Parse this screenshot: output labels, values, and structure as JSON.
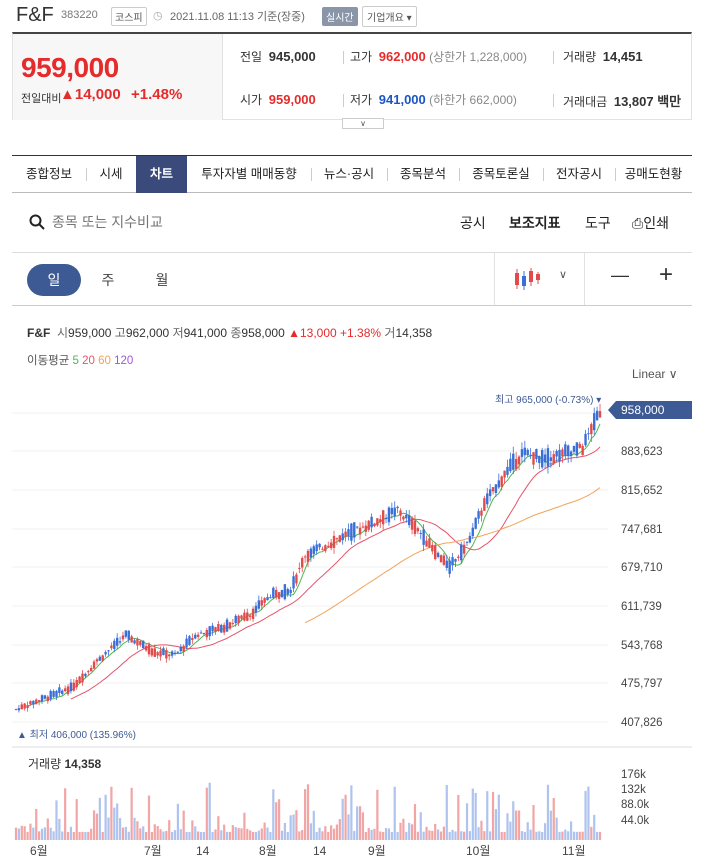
{
  "header": {
    "name": "F&F",
    "code": "383220",
    "market": "코스피",
    "time": "2021.11.08 11:13 기준(장중)",
    "realtime": "실시간",
    "company_info": "기업개요 ▾"
  },
  "quote": {
    "price": "959,000",
    "change_label": "전일대비",
    "change": "▲14,000",
    "change_pct": "+1.48%",
    "prev_label": "전일",
    "prev": "945,000",
    "high_label": "고가",
    "high": "962,000",
    "upper_limit": "(상한가 1,228,000)",
    "volume_label": "거래량",
    "volume": "14,451",
    "open_label": "시가",
    "open": "959,000",
    "low_label": "저가",
    "low": "941,000",
    "lower_limit": "(하한가 662,000)",
    "amount_label": "거래대금",
    "amount": "13,807 백만"
  },
  "tabs": [
    "종합정보",
    "시세",
    "차트",
    "투자자별 매매동향",
    "뉴스·공시",
    "종목분석",
    "종목토론실",
    "전자공시",
    "공매도현황"
  ],
  "search": {
    "placeholder": "종목 또는 지수비교"
  },
  "tools": {
    "disclosure": "공시",
    "indicator": "보조지표",
    "drawing": "도구",
    "print": "인쇄"
  },
  "periods": [
    "일",
    "주",
    "월"
  ],
  "controls": {
    "zoom_out": "—",
    "zoom_in": "+"
  },
  "info": {
    "name": "F&F",
    "open_label": "시",
    "open": "959,000",
    "high_label": "고",
    "high": "962,000",
    "low_label": "저",
    "low": "941,000",
    "close_label": "종",
    "close": "958,000",
    "change": "▲13,000 +1.38%",
    "vol_label": "거",
    "vol": "14,358"
  },
  "ma": {
    "label": "이동평균",
    "p5": "5",
    "p20": "20",
    "p60": "60",
    "p120": "120"
  },
  "scale": "Linear",
  "chart_data": {
    "type": "candlestick",
    "y_ticks": [
      "407,826",
      "475,797",
      "543,768",
      "611,739",
      "679,710",
      "747,681",
      "815,652",
      "883,623"
    ],
    "current_tag": "958,000",
    "max_label": "최고 965,000 (-0.73%)",
    "min_label": "최저 406,000 (135.96%)",
    "x_labels": [
      "6월",
      "7월",
      "14",
      "8월",
      "14",
      "9월",
      "10월",
      "11월"
    ],
    "volume_label": "거래량",
    "volume_value": "14,358",
    "volume_ticks": [
      "176k",
      "132k",
      "88.0k",
      "44.0k"
    ],
    "ma_colors": {
      "ma5": "#4fb84f",
      "ma20": "#e5536b",
      "ma60": "#f0a45a",
      "ma120": "#9b59d9"
    },
    "up_color": "#e24b4b",
    "down_color": "#3b6fd8"
  }
}
